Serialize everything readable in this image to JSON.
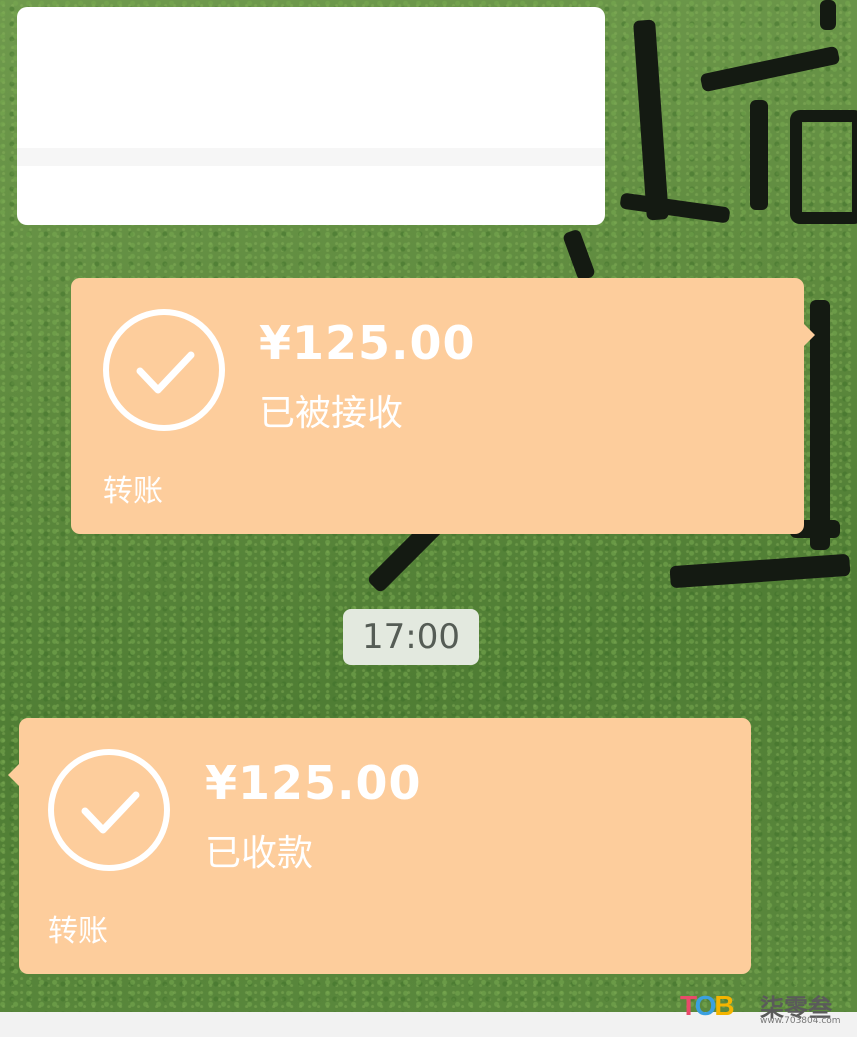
{
  "chat": {
    "timestamp": "17:00",
    "messages": [
      {
        "side": "right",
        "amount": "¥125.00",
        "status": "已被接收",
        "type_label": "转账"
      },
      {
        "side": "left",
        "amount": "¥125.00",
        "status": "已收款",
        "type_label": "转账"
      }
    ]
  },
  "watermark": {
    "logo": "TOB",
    "name": "柒零叁",
    "url": "www.703804.com"
  },
  "colors": {
    "transfer_bubble": "#fdcd9c",
    "check_icon": "#ffffff",
    "timestamp_bg": "#e3e9df"
  }
}
